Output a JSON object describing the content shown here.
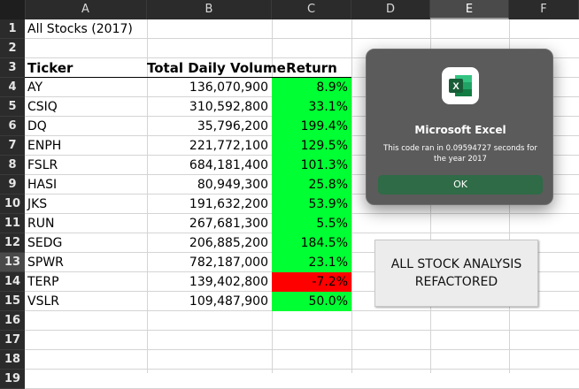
{
  "columns": [
    "A",
    "B",
    "C",
    "D",
    "E",
    "F"
  ],
  "rows": [
    "1",
    "2",
    "3",
    "4",
    "5",
    "6",
    "7",
    "8",
    "9",
    "10",
    "11",
    "12",
    "13",
    "14",
    "15",
    "16",
    "17",
    "18",
    "19"
  ],
  "title_cell": "All Stocks (2017)",
  "headers": {
    "ticker": "Ticker",
    "volume": "Total Daily Volume",
    "return": "Return"
  },
  "stocks": [
    {
      "ticker": "AY",
      "volume": "136,070,900",
      "return": "8.9%"
    },
    {
      "ticker": "CSIQ",
      "volume": "310,592,800",
      "return": "33.1%"
    },
    {
      "ticker": "DQ",
      "volume": "35,796,200",
      "return": "199.4%"
    },
    {
      "ticker": "ENPH",
      "volume": "221,772,100",
      "return": "129.5%"
    },
    {
      "ticker": "FSLR",
      "volume": "684,181,400",
      "return": "101.3%"
    },
    {
      "ticker": "HASI",
      "volume": "80,949,300",
      "return": "25.8%"
    },
    {
      "ticker": "JKS",
      "volume": "191,632,200",
      "return": "53.9%"
    },
    {
      "ticker": "RUN",
      "volume": "267,681,300",
      "return": "5.5%"
    },
    {
      "ticker": "SEDG",
      "volume": "206,885,200",
      "return": "184.5%"
    },
    {
      "ticker": "SPWR",
      "volume": "782,187,000",
      "return": "23.1%"
    },
    {
      "ticker": "TERP",
      "volume": "139,402,800",
      "return": "-7.2%"
    },
    {
      "ticker": "VSLR",
      "volume": "109,487,900",
      "return": "50.0%"
    }
  ],
  "macro_button": {
    "label": "ALL STOCK ANALYSIS\nREFACTORED"
  },
  "dialog": {
    "title": "Microsoft Excel",
    "message": "This code ran in 0.09594727 seconds for the year 2017",
    "ok_label": "OK"
  },
  "colors": {
    "positive": "#00ff33",
    "negative": "#ff0000",
    "ok_button": "#2e6b46",
    "excel_green": "#1d6f42"
  },
  "selected": {
    "column": "E",
    "row": "13"
  }
}
